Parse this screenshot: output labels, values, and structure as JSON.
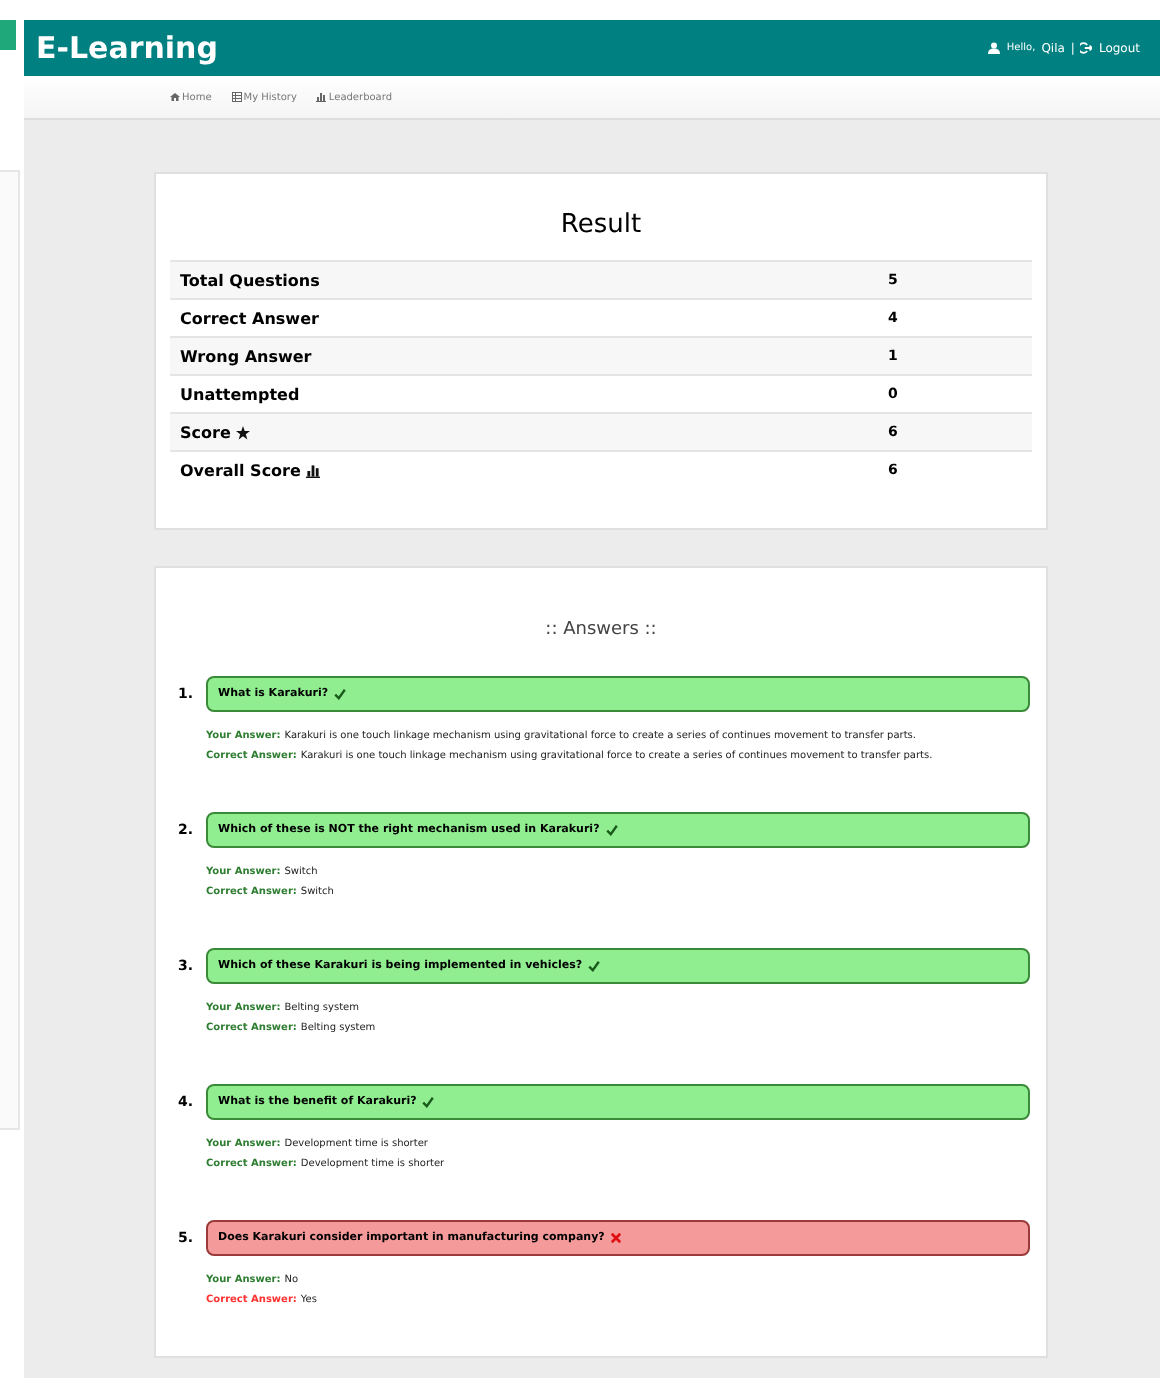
{
  "header": {
    "title": "E-Learning",
    "greeting": "Hello,",
    "user": "Qila",
    "separator": "|",
    "logout": "Logout"
  },
  "nav": [
    {
      "label": "Home",
      "kind": "home"
    },
    {
      "label": "My History",
      "kind": "list"
    },
    {
      "label": "Leaderboard",
      "kind": "bars"
    }
  ],
  "result": {
    "title": "Result",
    "rows": [
      {
        "label": "Total Questions",
        "value": "5"
      },
      {
        "label": "Correct Answer",
        "value": "4"
      },
      {
        "label": "Wrong Answer",
        "value": "1"
      },
      {
        "label": "Unattempted",
        "value": "0"
      },
      {
        "label": "Score",
        "kind": "star",
        "value": "6"
      },
      {
        "label": "Overall Score",
        "kind": "bars",
        "value": "6"
      }
    ]
  },
  "answers": {
    "title": ":: Answers ::",
    "items": [
      {
        "number": "1.",
        "question": "What is Karakuri?",
        "correct": true,
        "your_label": "Your Answer:",
        "your_answer": "Karakuri is one touch linkage mechanism using gravitational force to create a series of continues movement to transfer parts.",
        "correct_label": "Correct Answer:",
        "correct_answer": "Karakuri is one touch linkage mechanism using gravitational force to create a series of continues movement to transfer parts."
      },
      {
        "number": "2.",
        "question": "Which of these is NOT the right mechanism used in Karakuri?",
        "correct": true,
        "your_label": "Your Answer:",
        "your_answer": "Switch",
        "correct_label": "Correct Answer:",
        "correct_answer": "Switch"
      },
      {
        "number": "3.",
        "question": "Which of these Karakuri is being implemented in vehicles?",
        "correct": true,
        "your_label": "Your Answer:",
        "your_answer": "Belting system",
        "correct_label": "Correct Answer:",
        "correct_answer": "Belting system"
      },
      {
        "number": "4.",
        "question": "What is the benefit of Karakuri?",
        "correct": true,
        "your_label": "Your Answer:",
        "your_answer": "Development time is shorter",
        "correct_label": "Correct Answer:",
        "correct_answer": "Development time is shorter"
      },
      {
        "number": "5.",
        "question": "Does Karakuri consider important in manufacturing company?",
        "correct": false,
        "your_label": "Your Answer:",
        "your_answer": "No",
        "correct_label": "Correct Answer:",
        "correct_answer": "Yes"
      }
    ]
  }
}
